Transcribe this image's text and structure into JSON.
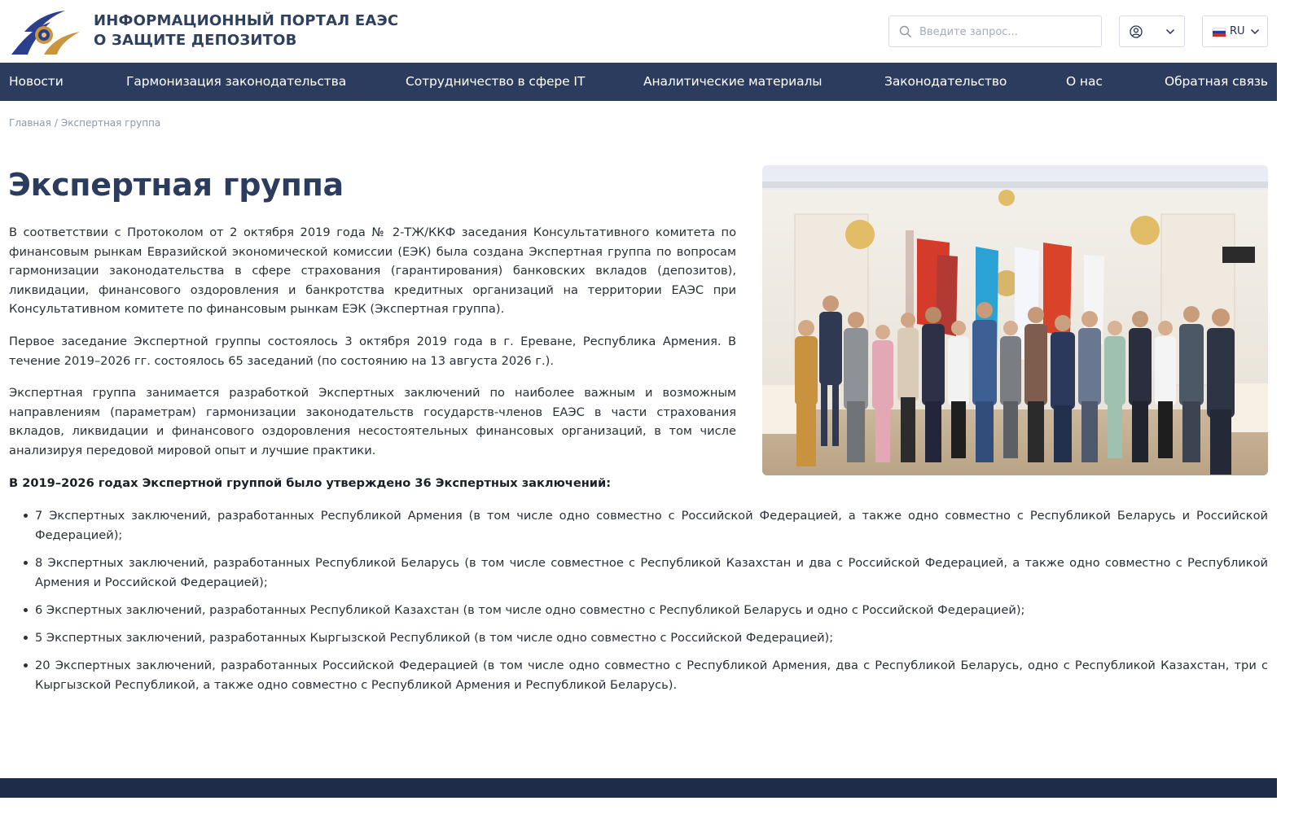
{
  "header": {
    "title_line1": "ИНФОРМАЦИОННЫЙ ПОРТАЛ ЕАЭС",
    "title_line2": "О ЗАЩИТЕ ДЕПОЗИТОВ",
    "search_placeholder": "Введите запрос...",
    "user_icon": "user-circle-icon",
    "language": "RU"
  },
  "nav": {
    "items": [
      "Новости",
      "Гармонизация законодательства",
      "Сотрудничество в сфере IT",
      "Аналитические материалы",
      "Законодательство",
      "О нас",
      "Обратная связь"
    ]
  },
  "breadcrumb": {
    "home": "Главная",
    "separator": "/",
    "current": "Экспертная группа"
  },
  "main": {
    "title": "Экспертная группа",
    "paragraphs": [
      "В соответствии с Протоколом от 2 октября 2019 года № 2-ТЖ/ККФ заседания Консультативного комитета по финансовым рынкам Евразийской экономической комиссии (ЕЭК) была создана Экспертная группа по вопросам гармонизации законодательства в сфере страхования (гарантирования) банковских вкладов (депозитов), ликвидации, финансового оздоровления и банкротства кредитных организаций на территории ЕАЭС при Консультативном комитете по финансовым рынкам ЕЭК (Экспертная группа).",
      "Первое заседание Экспертной группы состоялось 3 октября 2019 года в г. Ереване, Республика Армения. В течение 2019–2026 гг. состоялось 65 заседаний (по состоянию на 13 августа 2026 г.).",
      "Экспертная группа занимается разработкой Экспертных заключений по наиболее важным и возможным направлениям (параметрам) гармонизации законодательств государств-членов ЕАЭС в части страхования вкладов, ликвидации и финансового оздоровления несостоятельных финансовых организаций, в том числе анализируя передовой мировой опыт и лучшие практики."
    ],
    "list_heading": "В 2019–2026 годах Экспертной группой было утверждено 36 Экспертных заключений:",
    "list_items": [
      "7 Экспертных заключений, разработанных Республикой Армения (в том числе одно совместно с Российской Федерацией, а также одно совместно с Республикой Беларусь и Российской Федерацией);",
      "8 Экспертных заключений, разработанных Республикой Беларусь (в том числе совместное с Республикой Казахстан и два с Российской Федерацией, а также одно совместно с Республикой Армения и Российской Федерацией);",
      "6 Экспертных заключений, разработанных Республикой Казахстан (в том числе одно совместно с Республикой Беларусь и одно с Российской Федерацией);",
      "5 Экспертных заключений, разработанных Кыргызской Республикой (в том числе одно совместно с Российской Федерацией);",
      "20 Экспертных заключений, разработанных Российской Федерацией (в том числе одно совместно с Республикой Армения, два с Республикой Беларусь, одно с Республикой Казахстан, три с Кыргызской Республикой, а также одно совместно с Республикой Армения и Республикой Беларусь)."
    ]
  },
  "colors": {
    "nav_bg": "#2c3c5f",
    "title": "#2c3c5f",
    "logo_gold": "#c9963e",
    "logo_blue": "#2b3f8c",
    "footer": "#1f2c49"
  }
}
